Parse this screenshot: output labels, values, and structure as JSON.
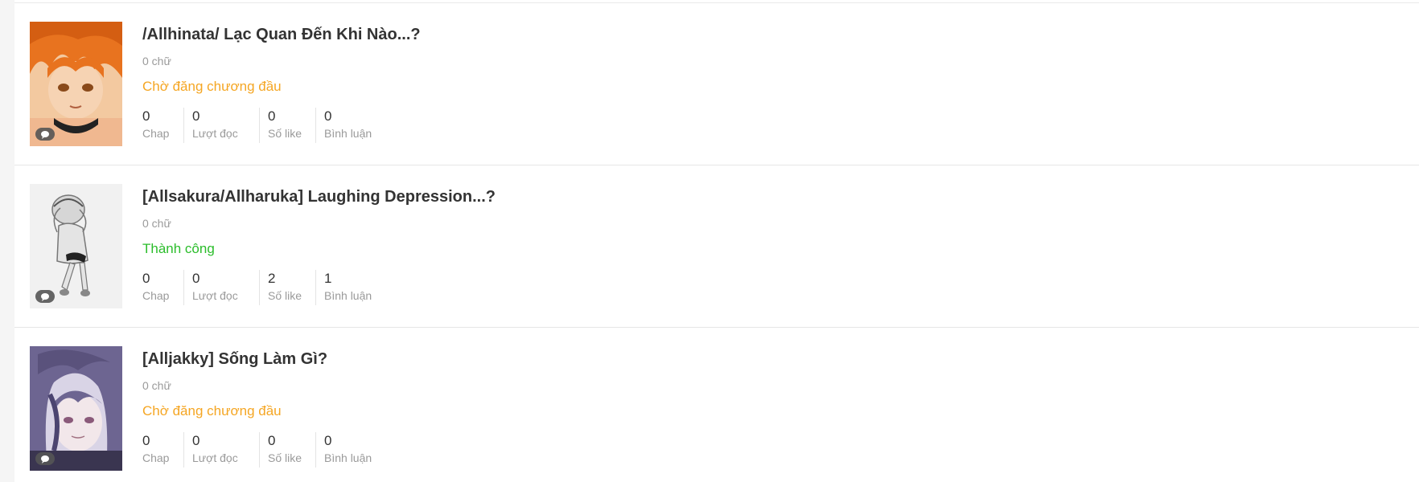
{
  "stories": [
    {
      "title": "/Allhinata/ Lạc Quan Đến Khi Nào...?",
      "word_count": "0 chữ",
      "status": "Chờ đăng chương đầu",
      "status_type": "pending",
      "stats": [
        {
          "value": "0",
          "label": "Chap"
        },
        {
          "value": "0",
          "label": "Lượt đọc"
        },
        {
          "value": "0",
          "label": "Số like"
        },
        {
          "value": "0",
          "label": "Bình luận"
        }
      ]
    },
    {
      "title": "[Allsakura/Allharuka] Laughing Depression...?",
      "word_count": "0 chữ",
      "status": "Thành công",
      "status_type": "success",
      "stats": [
        {
          "value": "0",
          "label": "Chap"
        },
        {
          "value": "0",
          "label": "Lượt đọc"
        },
        {
          "value": "2",
          "label": "Số like"
        },
        {
          "value": "1",
          "label": "Bình luận"
        }
      ]
    },
    {
      "title": "[Alljakky] Sống Làm Gì?",
      "word_count": "0 chữ",
      "status": "Chờ đăng chương đầu",
      "status_type": "pending",
      "stats": [
        {
          "value": "0",
          "label": "Chap"
        },
        {
          "value": "0",
          "label": "Lượt đọc"
        },
        {
          "value": "0",
          "label": "Số like"
        },
        {
          "value": "0",
          "label": "Bình luận"
        }
      ]
    }
  ],
  "colors": {
    "pending": "#f5a623",
    "success": "#2bbd2b",
    "title": "#333333",
    "muted": "#9a9a9a"
  },
  "icons": {
    "comment_badge": "chat-bubble-icon"
  }
}
